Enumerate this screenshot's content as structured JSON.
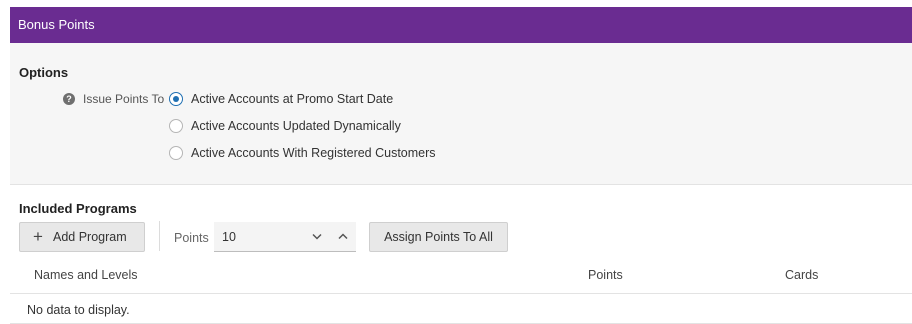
{
  "panel": {
    "title": "Bonus Points"
  },
  "options": {
    "title": "Options",
    "issue_points_label": "Issue Points To",
    "help_icon": "help-question-icon",
    "radio_options": [
      {
        "label": "Active Accounts at Promo Start Date",
        "selected": true
      },
      {
        "label": "Active Accounts Updated Dynamically",
        "selected": false
      },
      {
        "label": "Active Accounts With Registered Customers",
        "selected": false
      }
    ]
  },
  "included_programs": {
    "title": "Included Programs",
    "add_program_label": "Add Program",
    "add_icon": "plus-icon",
    "points_label": "Points",
    "points_value": "10",
    "decrement_icon": "chevron-down-icon",
    "increment_icon": "chevron-up-icon",
    "assign_button_label": "Assign Points To All",
    "table": {
      "columns": [
        "Names and Levels",
        "Points",
        "Cards"
      ],
      "empty_message": "No data to display."
    }
  },
  "colors": {
    "header_bg": "#6a2c91",
    "radio_selected": "#1f6fb2",
    "options_bg": "#f6f6f6"
  }
}
